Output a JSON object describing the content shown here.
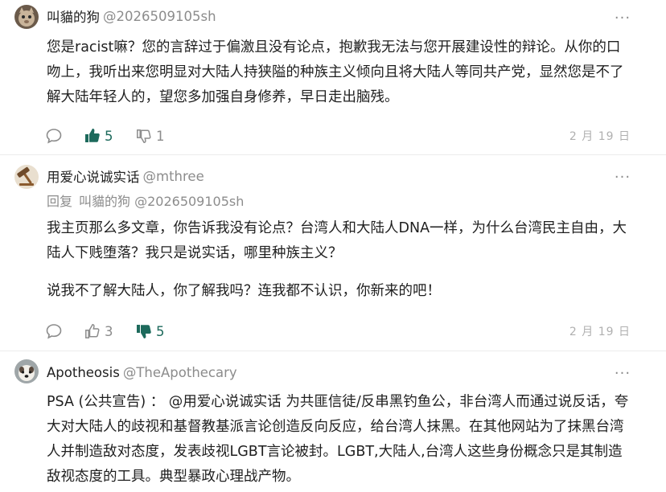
{
  "comments": [
    {
      "author": "叫貓的狗",
      "handle": "@2026509105sh",
      "reply_label": "",
      "reply_to": "",
      "paragraphs": [
        "您是racist嘛？您的言辞过于偏激且没有论点，抱歉我无法与您开展建设性的辩论。从你的口吻上，我听出来您明显对大陆人持狭隘的种族主义倾向且将大陆人等同共产党，显然您是不了解大陆年轻人的，望您多加强自身修养，早日走出脑残。"
      ],
      "likes": "5",
      "dislikes": "1",
      "liked": true,
      "disliked": false,
      "date": "2 月 19 日",
      "avatar_icon": "cat-avatar-icon"
    },
    {
      "author": "用爱心说诚实话",
      "handle": "@mthree",
      "reply_label": "回复",
      "reply_to": "叫貓的狗 @2026509105sh",
      "paragraphs": [
        "我主页那么多文章，你告诉我没有论点？台湾人和大陆人DNA一样，为什么台湾民主自由，大陆人下贱堕落？我只是说实话，哪里种族主义？",
        "说我不了解大陆人，你了解我吗？连我都不认识，你新来的吧！"
      ],
      "likes": "3",
      "dislikes": "5",
      "liked": false,
      "disliked": true,
      "date": "2 月 19 日",
      "avatar_icon": "hammer-avatar-icon"
    },
    {
      "author": "Apotheosis",
      "handle": "@TheApothecary",
      "reply_label": "",
      "reply_to": "",
      "paragraphs": [
        "PSA (公共宣告) ： @用爱心说诚实话 为共匪信徒/反串黑钓鱼公，非台湾人而通过说反话，夸大对大陆人的歧视和基督教基派言论创造反向反应，给台湾人抹黑。在其他网站为了抹黑台湾人并制造敌对态度，发表歧视LGBT言论被封。LGBT,大陆人,台湾人这些身份概念只是其制造敌视态度的工具。典型暴政心理战产物。"
      ],
      "avatar_icon": "dog-avatar-icon"
    }
  ],
  "icons": {
    "more": "more-options-icon",
    "reply": "speech-bubble-icon",
    "like": "thumbs-up-icon",
    "dislike": "thumbs-down-icon"
  },
  "colors": {
    "active_vote": "#1d6a5c",
    "muted": "#8c8c8c",
    "text": "#1f1f1f"
  }
}
